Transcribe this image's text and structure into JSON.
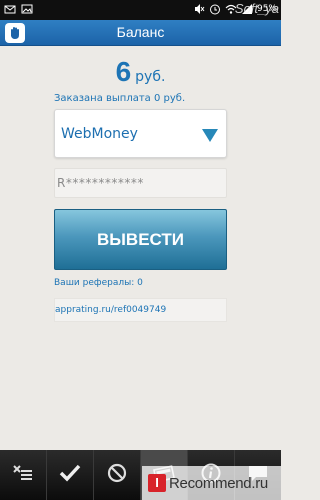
{
  "status_bar": {
    "battery": "95%",
    "watermark": "Soft_ya"
  },
  "header": {
    "title": "Баланс",
    "logo_icon": "hand-logo-icon"
  },
  "balance": {
    "amount": "6",
    "currency": "руб."
  },
  "payout_text": "Заказана выплата 0 руб.",
  "payment_system": {
    "selected": "WebMoney"
  },
  "wallet": {
    "value": "R************"
  },
  "withdraw_button": "ВЫВЕСТИ",
  "referrals_text": "Ваши рефералы: 0",
  "referral_link": "apprating.ru/ref0049749",
  "toolbar": {
    "items": [
      {
        "icon": "list-icon"
      },
      {
        "icon": "checkmark-icon"
      },
      {
        "icon": "block-icon"
      },
      {
        "icon": "wallet-icon"
      },
      {
        "icon": "info-icon"
      },
      {
        "icon": "chat-icon"
      }
    ]
  },
  "watermark_bottom": {
    "logo": "I",
    "text": "Recommend.ru"
  },
  "colors": {
    "accent": "#1d74b5",
    "header": "#2f7fc3",
    "button": "#4b97bc"
  }
}
